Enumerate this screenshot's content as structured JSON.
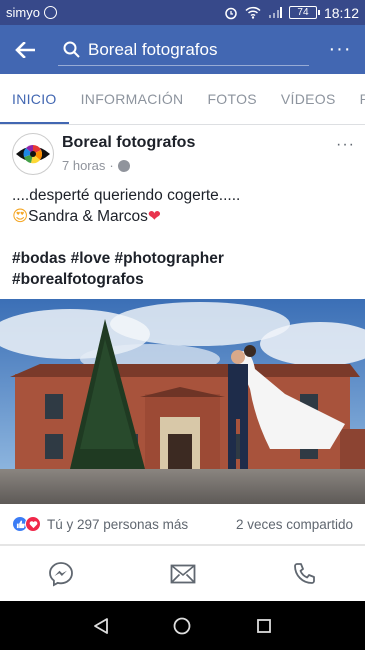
{
  "status_bar": {
    "carrier": "simyo",
    "battery": "74",
    "time": "18:12"
  },
  "app_bar": {
    "search_text": "Boreal fotografos",
    "more": "···"
  },
  "tabs": [
    {
      "label": "INICIO",
      "active": true
    },
    {
      "label": "INFORMACIÓN",
      "active": false
    },
    {
      "label": "FOTOS",
      "active": false
    },
    {
      "label": "VÍDEOS",
      "active": false
    },
    {
      "label": "PUBL",
      "active": false
    }
  ],
  "post": {
    "page_name": "Boreal fotografos",
    "time": "7 horas",
    "separator": "·",
    "menu": "···",
    "text_line1": "....desperté queriendo cogerte.....",
    "emoji_face": "😍",
    "text_line2": "Sandra & Marcos",
    "emoji_heart": "❤",
    "hashtags_line1": "#bodas #love #photographer",
    "hashtags_line2": "#borealfotografos",
    "reactions_text": "Tú y 297 personas más",
    "shares_text": "2 veces compartido"
  },
  "colors": {
    "status_bar": "#37498a",
    "app_bar": "#4267b2",
    "accent": "#4267b2",
    "like": "#3b7cf5",
    "love": "#f0284a"
  },
  "icons": [
    "back-arrow-icon",
    "search-icon",
    "messenger-icon",
    "mail-icon",
    "phone-icon",
    "globe-icon"
  ]
}
